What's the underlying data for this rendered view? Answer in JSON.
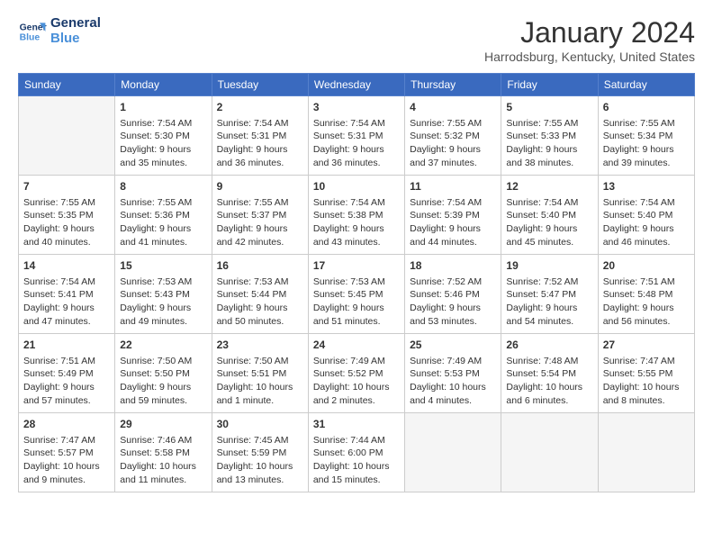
{
  "header": {
    "logo_line1": "General",
    "logo_line2": "Blue",
    "month_title": "January 2024",
    "location": "Harrodsburg, Kentucky, United States"
  },
  "days_of_week": [
    "Sunday",
    "Monday",
    "Tuesday",
    "Wednesday",
    "Thursday",
    "Friday",
    "Saturday"
  ],
  "weeks": [
    [
      {
        "day": "",
        "info": ""
      },
      {
        "day": "1",
        "info": "Sunrise: 7:54 AM\nSunset: 5:30 PM\nDaylight: 9 hours\nand 35 minutes."
      },
      {
        "day": "2",
        "info": "Sunrise: 7:54 AM\nSunset: 5:31 PM\nDaylight: 9 hours\nand 36 minutes."
      },
      {
        "day": "3",
        "info": "Sunrise: 7:54 AM\nSunset: 5:31 PM\nDaylight: 9 hours\nand 36 minutes."
      },
      {
        "day": "4",
        "info": "Sunrise: 7:55 AM\nSunset: 5:32 PM\nDaylight: 9 hours\nand 37 minutes."
      },
      {
        "day": "5",
        "info": "Sunrise: 7:55 AM\nSunset: 5:33 PM\nDaylight: 9 hours\nand 38 minutes."
      },
      {
        "day": "6",
        "info": "Sunrise: 7:55 AM\nSunset: 5:34 PM\nDaylight: 9 hours\nand 39 minutes."
      }
    ],
    [
      {
        "day": "7",
        "info": "Sunrise: 7:55 AM\nSunset: 5:35 PM\nDaylight: 9 hours\nand 40 minutes."
      },
      {
        "day": "8",
        "info": "Sunrise: 7:55 AM\nSunset: 5:36 PM\nDaylight: 9 hours\nand 41 minutes."
      },
      {
        "day": "9",
        "info": "Sunrise: 7:55 AM\nSunset: 5:37 PM\nDaylight: 9 hours\nand 42 minutes."
      },
      {
        "day": "10",
        "info": "Sunrise: 7:54 AM\nSunset: 5:38 PM\nDaylight: 9 hours\nand 43 minutes."
      },
      {
        "day": "11",
        "info": "Sunrise: 7:54 AM\nSunset: 5:39 PM\nDaylight: 9 hours\nand 44 minutes."
      },
      {
        "day": "12",
        "info": "Sunrise: 7:54 AM\nSunset: 5:40 PM\nDaylight: 9 hours\nand 45 minutes."
      },
      {
        "day": "13",
        "info": "Sunrise: 7:54 AM\nSunset: 5:40 PM\nDaylight: 9 hours\nand 46 minutes."
      }
    ],
    [
      {
        "day": "14",
        "info": "Sunrise: 7:54 AM\nSunset: 5:41 PM\nDaylight: 9 hours\nand 47 minutes."
      },
      {
        "day": "15",
        "info": "Sunrise: 7:53 AM\nSunset: 5:43 PM\nDaylight: 9 hours\nand 49 minutes."
      },
      {
        "day": "16",
        "info": "Sunrise: 7:53 AM\nSunset: 5:44 PM\nDaylight: 9 hours\nand 50 minutes."
      },
      {
        "day": "17",
        "info": "Sunrise: 7:53 AM\nSunset: 5:45 PM\nDaylight: 9 hours\nand 51 minutes."
      },
      {
        "day": "18",
        "info": "Sunrise: 7:52 AM\nSunset: 5:46 PM\nDaylight: 9 hours\nand 53 minutes."
      },
      {
        "day": "19",
        "info": "Sunrise: 7:52 AM\nSunset: 5:47 PM\nDaylight: 9 hours\nand 54 minutes."
      },
      {
        "day": "20",
        "info": "Sunrise: 7:51 AM\nSunset: 5:48 PM\nDaylight: 9 hours\nand 56 minutes."
      }
    ],
    [
      {
        "day": "21",
        "info": "Sunrise: 7:51 AM\nSunset: 5:49 PM\nDaylight: 9 hours\nand 57 minutes."
      },
      {
        "day": "22",
        "info": "Sunrise: 7:50 AM\nSunset: 5:50 PM\nDaylight: 9 hours\nand 59 minutes."
      },
      {
        "day": "23",
        "info": "Sunrise: 7:50 AM\nSunset: 5:51 PM\nDaylight: 10 hours\nand 1 minute."
      },
      {
        "day": "24",
        "info": "Sunrise: 7:49 AM\nSunset: 5:52 PM\nDaylight: 10 hours\nand 2 minutes."
      },
      {
        "day": "25",
        "info": "Sunrise: 7:49 AM\nSunset: 5:53 PM\nDaylight: 10 hours\nand 4 minutes."
      },
      {
        "day": "26",
        "info": "Sunrise: 7:48 AM\nSunset: 5:54 PM\nDaylight: 10 hours\nand 6 minutes."
      },
      {
        "day": "27",
        "info": "Sunrise: 7:47 AM\nSunset: 5:55 PM\nDaylight: 10 hours\nand 8 minutes."
      }
    ],
    [
      {
        "day": "28",
        "info": "Sunrise: 7:47 AM\nSunset: 5:57 PM\nDaylight: 10 hours\nand 9 minutes."
      },
      {
        "day": "29",
        "info": "Sunrise: 7:46 AM\nSunset: 5:58 PM\nDaylight: 10 hours\nand 11 minutes."
      },
      {
        "day": "30",
        "info": "Sunrise: 7:45 AM\nSunset: 5:59 PM\nDaylight: 10 hours\nand 13 minutes."
      },
      {
        "day": "31",
        "info": "Sunrise: 7:44 AM\nSunset: 6:00 PM\nDaylight: 10 hours\nand 15 minutes."
      },
      {
        "day": "",
        "info": ""
      },
      {
        "day": "",
        "info": ""
      },
      {
        "day": "",
        "info": ""
      }
    ]
  ]
}
